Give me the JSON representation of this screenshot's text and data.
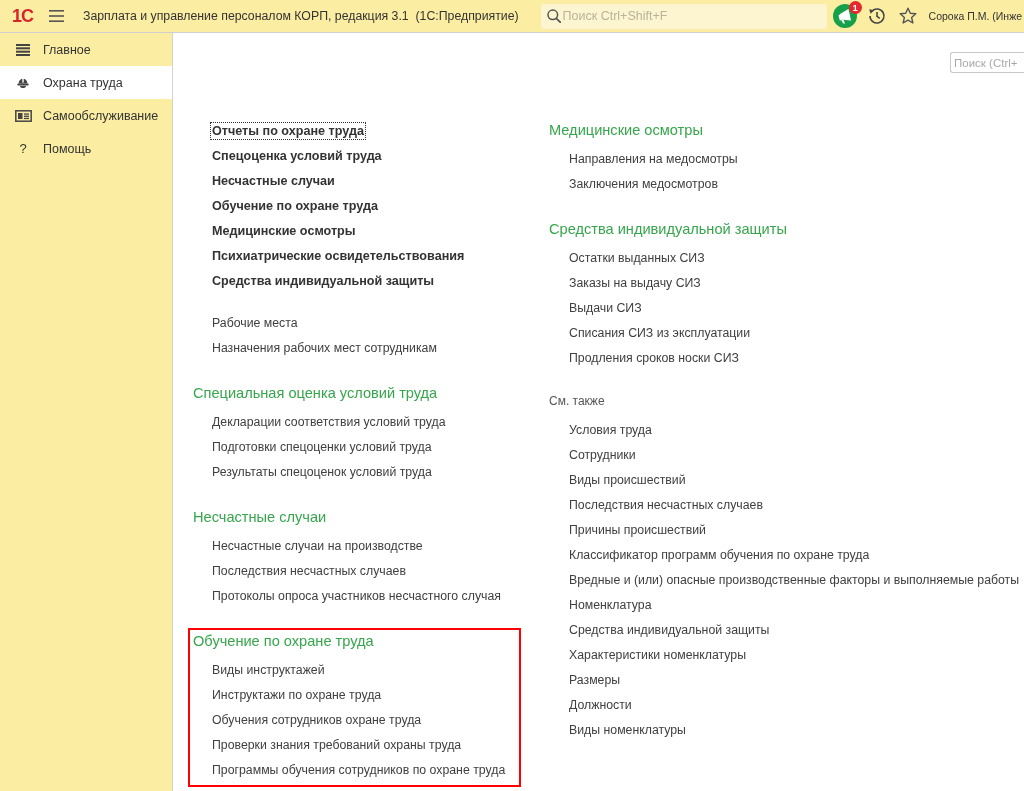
{
  "app_bar": {
    "logo": "1С",
    "title": "Зарплата и управление персоналом КОРП, редакция 3.1  (1С:Предприятие)",
    "search": {
      "placeholder": "Поиск Ctrl+Shift+F"
    },
    "notifications": {
      "count": "1"
    },
    "user": "Сорока П.М. (Инже"
  },
  "sidebar": {
    "items": [
      {
        "label": "Главное",
        "selected": false
      },
      {
        "label": "Охрана труда",
        "selected": true
      },
      {
        "label": "Самообслуживание",
        "selected": false
      },
      {
        "label": "Помощь",
        "glyph": "?",
        "selected": false
      }
    ]
  },
  "content": {
    "search": {
      "placeholder": "Поиск (Ctrl+"
    },
    "left_column": {
      "commands": [
        {
          "label": "Отчеты по охране труда",
          "focused": true
        },
        {
          "label": "Спецоценка условий труда",
          "focused": false
        },
        {
          "label": "Несчастные случаи",
          "focused": false
        },
        {
          "label": "Обучение по охране труда",
          "focused": false
        },
        {
          "label": "Медицинские осмотры",
          "focused": false
        },
        {
          "label": "Психиатрические освидетельствования",
          "focused": false
        },
        {
          "label": "Средства индивидуальной защиты",
          "focused": false
        }
      ],
      "links": [
        "Рабочие места",
        "Назначения рабочих мест сотрудникам"
      ],
      "sections": [
        {
          "title": "Специальная оценка условий труда",
          "highlighted": false,
          "items": [
            "Декларации соответствия условий труда",
            "Подготовки спецоценки условий труда",
            "Результаты спецоценок условий труда"
          ]
        },
        {
          "title": "Несчастные случаи",
          "highlighted": false,
          "items": [
            "Несчастные случаи на производстве",
            "Последствия несчастных случаев",
            "Протоколы опроса участников несчастного случая"
          ]
        },
        {
          "title": "Обучение по охране труда",
          "highlighted": true,
          "items": [
            "Виды инструктажей",
            "Инструктажи по охране труда",
            "Обучения сотрудников охране труда",
            "Проверки знания требований охраны труда",
            "Программы обучения сотрудников по охране труда"
          ]
        }
      ]
    },
    "right_column": {
      "sections": [
        {
          "title": "Медицинские осмотры",
          "highlighted": false,
          "items": [
            "Направления на медосмотры",
            "Заключения медосмотров"
          ]
        },
        {
          "title": "Средства индивидуальной защиты",
          "highlighted": false,
          "items": [
            "Остатки выданных СИЗ",
            "Заказы на выдачу СИЗ",
            "Выдачи СИЗ",
            "Списания СИЗ из эксплуатации",
            "Продления сроков носки СИЗ"
          ]
        }
      ],
      "see_also": {
        "title": "См. также",
        "items": [
          "Условия труда",
          "Сотрудники",
          "Виды происшествий",
          "Последствия несчастных случаев",
          "Причины происшествий",
          "Классификатор программ обучения по охране труда",
          "Вредные и (или) опасные производственные факторы и выполняемые работы",
          "Номенклатура",
          "Средства индивидуальной защиты",
          "Характеристики номенклатуры",
          "Размеры",
          "Должности",
          "Виды номенклатуры"
        ]
      }
    }
  }
}
